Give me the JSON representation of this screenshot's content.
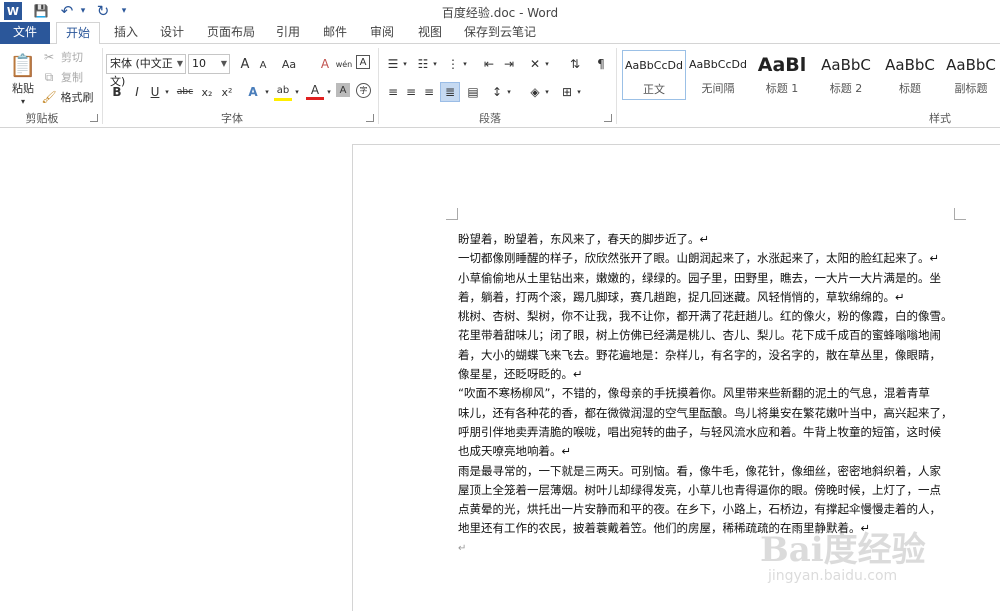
{
  "titlebar": {
    "title": "百度经验.doc - Word",
    "word_icon": "W",
    "save_icon": "💾",
    "undo_icon": "↶",
    "redo_icon": "↻",
    "more_icon": "▾"
  },
  "tabs": [
    "文件",
    "开始",
    "插入",
    "设计",
    "页面布局",
    "引用",
    "邮件",
    "审阅",
    "视图",
    "保存到云笔记"
  ],
  "clipboard": {
    "paste": "粘贴",
    "cut": "剪切",
    "copy": "复制",
    "format_painter": "格式刷",
    "group": "剪贴板"
  },
  "font": {
    "name": "宋体 (中文正文)",
    "size": "10",
    "group": "字体",
    "grow": "A",
    "shrink": "A",
    "case": "Aa",
    "clear": "A",
    "phonetic": "wén",
    "border_char": "A",
    "bold": "B",
    "italic": "I",
    "underline": "U",
    "strike": "abc",
    "sub": "x₂",
    "sup": "x²",
    "effects": "A",
    "highlight": "ab",
    "color": "A",
    "shade": "A",
    "enclose": "字"
  },
  "paragraph": {
    "group": "段落"
  },
  "styles": {
    "group": "样式",
    "items": [
      {
        "sample": "AaBbCcDd",
        "name": "正文"
      },
      {
        "sample": "AaBbCcDd",
        "name": "无间隔"
      },
      {
        "sample": "AaBl",
        "name": "标题 1"
      },
      {
        "sample": "AaBbC",
        "name": "标题 2"
      },
      {
        "sample": "AaBbC",
        "name": "标题"
      },
      {
        "sample": "AaBbC",
        "name": "副标题"
      }
    ]
  },
  "document": {
    "lines": [
      "盼望着，盼望着，东风来了，春天的脚步近了。↵",
      "一切都像刚睡醒的样子，欣欣然张开了眼。山朗润起来了，水涨起来了，太阳的脸红起来了。↵",
      "小草偷偷地从土里钻出来，嫩嫩的，绿绿的。园子里，田野里，瞧去，一大片一大片满是的。坐",
      "着，躺着，打两个滚，踢几脚球，赛几趟跑，捉几回迷藏。风轻悄悄的，草软绵绵的。↵",
      "桃树、杏树、梨树，你不让我，我不让你，都开满了花赶趟儿。红的像火，粉的像霞，白的像雪。",
      "花里带着甜味儿；闭了眼，树上仿佛已经满是桃儿、杏儿、梨儿。花下成千成百的蜜蜂嗡嗡地闹",
      "着，大小的蝴蝶飞来飞去。野花遍地是：杂样儿，有名字的，没名字的，散在草丛里，像眼睛，",
      "像星星，还眨呀眨的。↵",
      "“吹面不寒杨柳风”，不错的，像母亲的手抚摸着你。风里带来些新翻的泥土的气息，混着青草",
      "味儿，还有各种花的香，都在微微润湿的空气里酝酿。鸟儿将巢安在繁花嫩叶当中，高兴起来了，",
      "呼朋引伴地卖弄清脆的喉咙，唱出宛转的曲子，与轻风流水应和着。牛背上牧童的短笛，这时候",
      "也成天嘹亮地响着。↵",
      "雨是最寻常的，一下就是三两天。可别恼。看，像牛毛，像花针，像细丝，密密地斜织着，人家",
      "屋顶上全笼着一层薄烟。树叶儿却绿得发亮，小草儿也青得逼你的眼。傍晚时候，上灯了，一点",
      "点黄晕的光，烘托出一片安静而和平的夜。在乡下，小路上，石桥边，有撑起伞慢慢走着的人，",
      "地里还有工作的农民，披着蓑戴着笠。他们的房屋，稀稀疏疏的在雨里静默着。↵",
      "↵"
    ]
  },
  "watermark": {
    "logo": "Bai度经验",
    "url": "jingyan.baidu.com"
  }
}
